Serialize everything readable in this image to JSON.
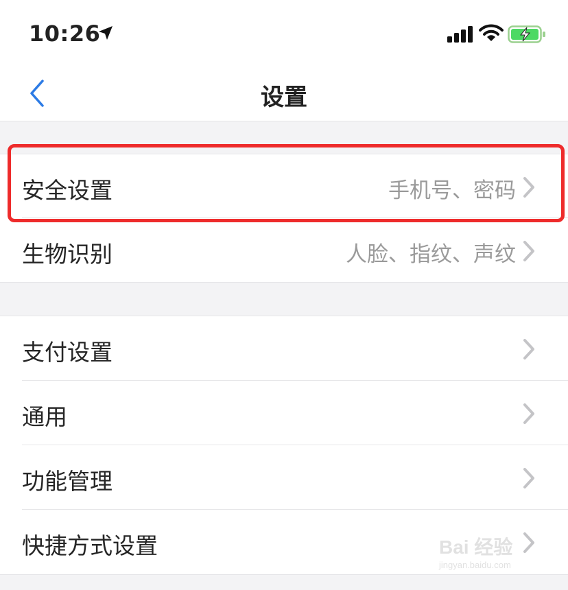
{
  "status_bar": {
    "time": "10:26",
    "icons": [
      "location-arrow-icon",
      "signal-icon",
      "wifi-icon",
      "battery-charging-icon"
    ]
  },
  "nav": {
    "title": "设置",
    "back_icon": "chevron-left-icon",
    "accent": "#2c7be5"
  },
  "groups": [
    {
      "items": [
        {
          "label": "安全设置",
          "value": "手机号、密码"
        },
        {
          "label": "生物识别",
          "value": "人脸、指纹、声纹"
        }
      ]
    },
    {
      "items": [
        {
          "label": "支付设置",
          "value": ""
        },
        {
          "label": "通用",
          "value": ""
        },
        {
          "label": "功能管理",
          "value": ""
        },
        {
          "label": "快捷方式设置",
          "value": ""
        }
      ]
    }
  ],
  "annotation": {
    "highlight_color": "#ee2b2b"
  },
  "watermark": {
    "main": "Bai 经验",
    "sub": "jingyan.baidu.com"
  }
}
